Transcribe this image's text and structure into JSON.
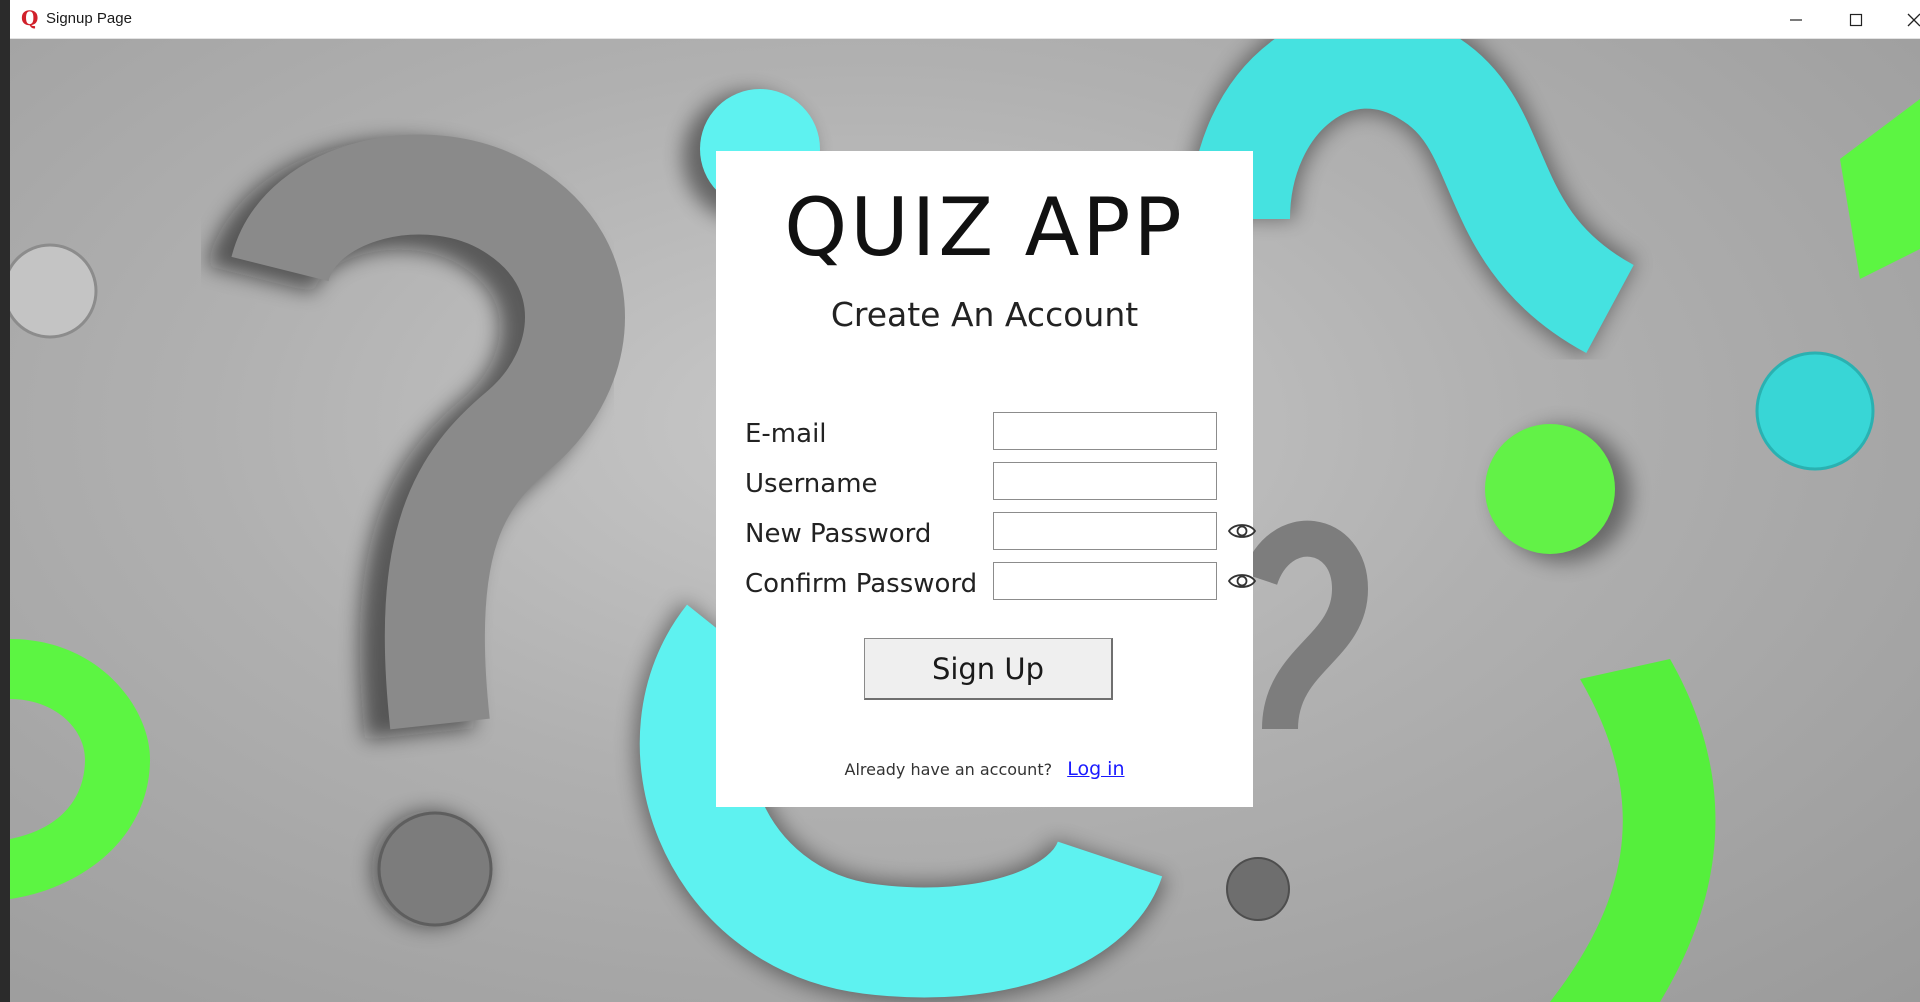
{
  "window": {
    "title": "Signup Page",
    "app_icon": "quiz-app-q-icon",
    "controls": [
      "minimize-icon",
      "maximize-icon",
      "close-icon"
    ]
  },
  "card": {
    "brand": "QUIZ APP",
    "subtitle": "Create An Account",
    "fields": {
      "email": {
        "label": "E-mail",
        "value": "",
        "placeholder": ""
      },
      "username": {
        "label": "Username",
        "value": "",
        "placeholder": ""
      },
      "new_password": {
        "label": "New Password",
        "value": "",
        "placeholder": "",
        "toggle_icon": "eye-icon"
      },
      "confirm_password": {
        "label": "Confirm Password",
        "value": "",
        "placeholder": "",
        "toggle_icon": "eye-icon"
      }
    },
    "signup_button": "Sign Up",
    "login_prompt": "Already have an account?",
    "login_link": "Log in"
  },
  "colors": {
    "accent_link": "#1a1aff",
    "app_icon": "#d1202a",
    "bg_cyan": "#5ef2f0",
    "bg_green": "#5cf542",
    "bg_gray": "#b5b5b5"
  }
}
